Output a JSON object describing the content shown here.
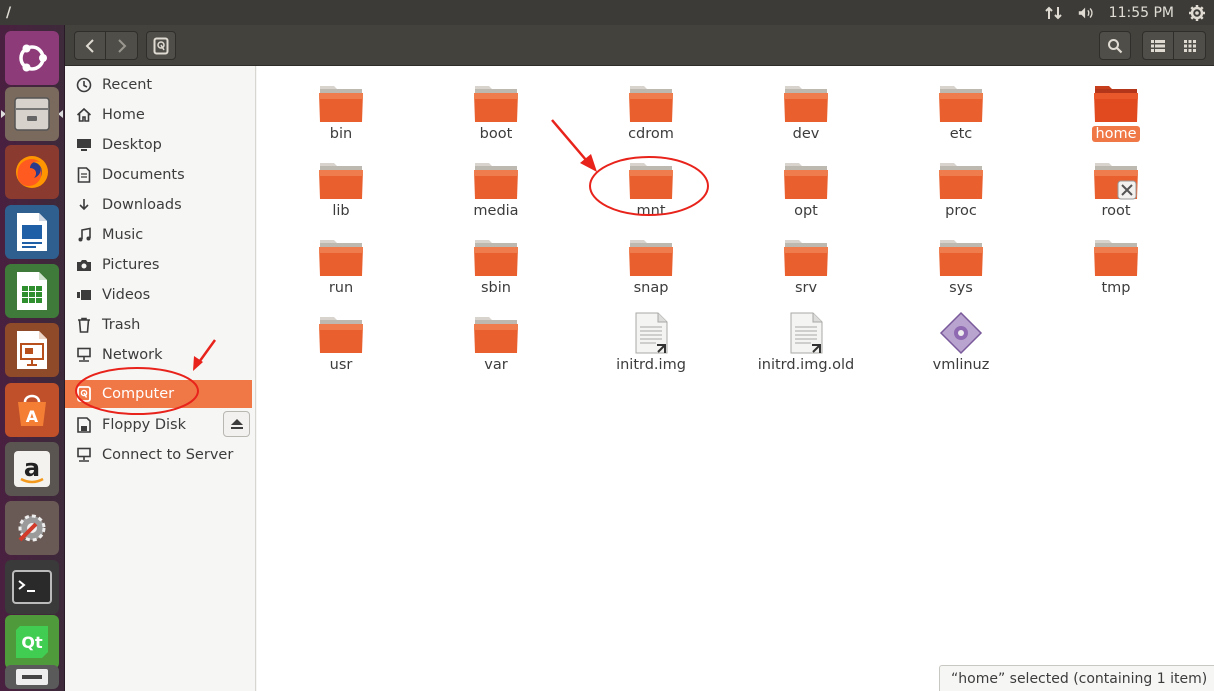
{
  "topbar": {
    "title": "/",
    "clock": "11:55 PM"
  },
  "header": {
    "back": "back",
    "forward": "forward"
  },
  "sidebar": {
    "items": [
      {
        "label": "Recent",
        "icon": "clock-icon"
      },
      {
        "label": "Home",
        "icon": "home-icon"
      },
      {
        "label": "Desktop",
        "icon": "desktop-icon"
      },
      {
        "label": "Documents",
        "icon": "document-icon"
      },
      {
        "label": "Downloads",
        "icon": "download-icon"
      },
      {
        "label": "Music",
        "icon": "music-icon"
      },
      {
        "label": "Pictures",
        "icon": "camera-icon"
      },
      {
        "label": "Videos",
        "icon": "video-icon"
      },
      {
        "label": "Trash",
        "icon": "trash-icon"
      },
      {
        "label": "Network",
        "icon": "network-icon"
      },
      {
        "label": "Computer",
        "icon": "drive-icon"
      },
      {
        "label": "Floppy Disk",
        "icon": "floppy-icon"
      },
      {
        "label": "Connect to Server",
        "icon": "server-icon"
      }
    ]
  },
  "files": [
    {
      "name": "bin",
      "type": "folder"
    },
    {
      "name": "boot",
      "type": "folder"
    },
    {
      "name": "cdrom",
      "type": "folder"
    },
    {
      "name": "dev",
      "type": "folder"
    },
    {
      "name": "etc",
      "type": "folder"
    },
    {
      "name": "home",
      "type": "folder"
    },
    {
      "name": "lib",
      "type": "folder"
    },
    {
      "name": "media",
      "type": "folder"
    },
    {
      "name": "mnt",
      "type": "folder"
    },
    {
      "name": "opt",
      "type": "folder"
    },
    {
      "name": "proc",
      "type": "folder"
    },
    {
      "name": "root",
      "type": "folder"
    },
    {
      "name": "run",
      "type": "folder"
    },
    {
      "name": "sbin",
      "type": "folder"
    },
    {
      "name": "snap",
      "type": "folder"
    },
    {
      "name": "srv",
      "type": "folder"
    },
    {
      "name": "sys",
      "type": "folder"
    },
    {
      "name": "tmp",
      "type": "folder"
    },
    {
      "name": "usr",
      "type": "folder"
    },
    {
      "name": "var",
      "type": "folder"
    },
    {
      "name": "initrd.img",
      "type": "file"
    },
    {
      "name": "initrd.img.old",
      "type": "file"
    },
    {
      "name": "vmlinuz",
      "type": "file"
    }
  ],
  "status": "“home” selected  (containing 1 item)",
  "colors": {
    "accent": "#f07746",
    "folder": "#e9602e",
    "annotation": "#e8231b"
  }
}
